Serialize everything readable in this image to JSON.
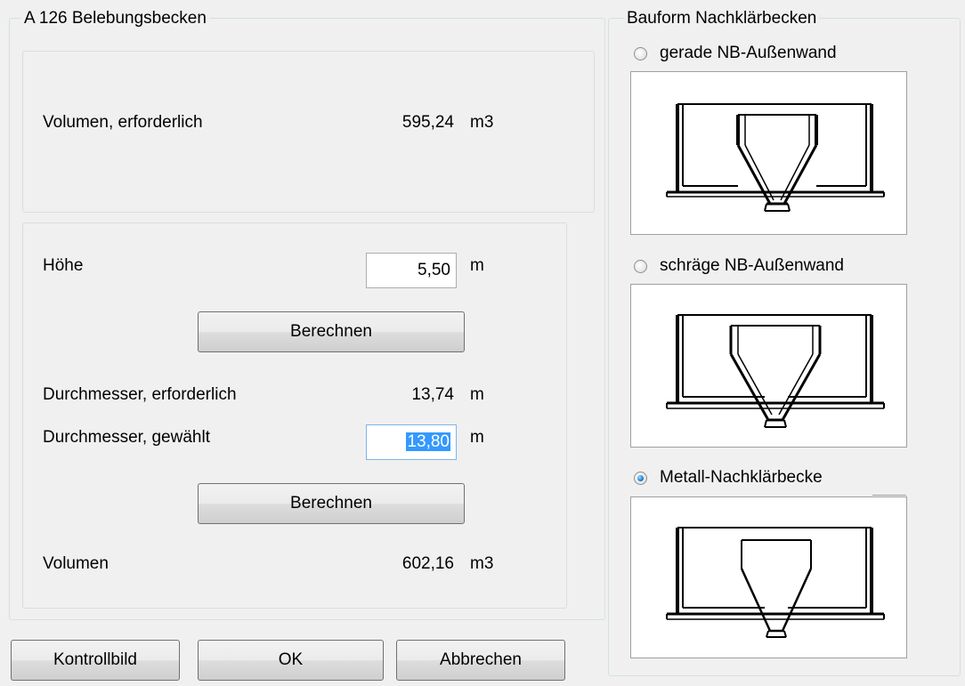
{
  "left_group": {
    "title": "A 126 Belebungsbecken",
    "volume_required": {
      "label": "Volumen, erforderlich",
      "value": "595,24",
      "unit": "m3"
    },
    "height": {
      "label": "Höhe",
      "value": "5,50",
      "unit": "m"
    },
    "calc_button_1": "Berechnen",
    "diameter_required": {
      "label": "Durchmesser, erforderlich",
      "value": "13,74",
      "unit": "m"
    },
    "diameter_chosen": {
      "label": "Durchmesser, gewählt",
      "value": "13,80",
      "unit": "m"
    },
    "calc_button_2": "Berechnen",
    "volume": {
      "label": "Volumen",
      "value": "602,16",
      "unit": "m3"
    }
  },
  "right_group": {
    "title": "Bauform Nachklärbecken",
    "options": [
      {
        "label": "gerade NB-Außenwand",
        "checked": false
      },
      {
        "label": "schräge NB-Außenwand",
        "checked": false
      },
      {
        "label": "Metall-Nachklärbecke",
        "checked": true
      }
    ]
  },
  "footer": {
    "kontrollbild": "Kontrollbild",
    "ok": "OK",
    "cancel": "Abbrechen"
  }
}
